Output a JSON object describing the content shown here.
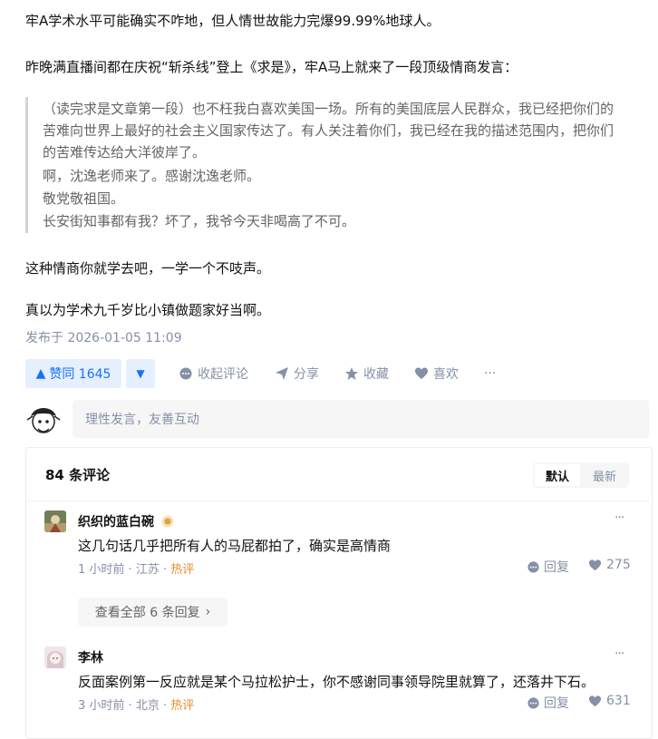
{
  "article": {
    "p1": "牢A学术水平可能确实不咋地，但人情世故能力完爆99.99%地球人。",
    "p2": "昨晚满直播间都在庆祝“斩杀线”登上《求是》，牢A马上就来了一段顶级情商发言：",
    "quote": [
      "（读完求是文章第一段）也不枉我白喜欢美国一场。所有的美国底层人民群众，我已经把你们的",
      "苦难向世界上最好的社会主义国家传达了。有人关注着你们，我已经在我的描述范围内，把你们",
      "的苦难传达给大洋彼岸了。",
      "啊，沈逸老师来了。感谢沈逸老师。",
      "敬党敬祖国。",
      "长安街知事都有我？坏了，我爷今天非喝高了不可。"
    ],
    "p3": "这种情商你就学去吧，一学一个不吱声。",
    "p4": "真以为学术九千岁比小镇做题家好当啊。",
    "published": "发布于 2026-01-05 11:09"
  },
  "actions": {
    "upvote": "赞同 1645",
    "collapse_comments": "收起评论",
    "share": "分享",
    "favorite": "收藏",
    "like": "喜欢",
    "more": "···"
  },
  "composer": {
    "placeholder": "理性发言，友善互动"
  },
  "comments": {
    "count": "84 条评论",
    "sort_default": "默认",
    "sort_latest": "最新",
    "items": [
      {
        "author": "织织的蓝白碗",
        "text": "这几句话几乎把所有人的马屁都拍了，确实是高情商",
        "time": "1 小时前",
        "location": "江苏",
        "tag": "热评",
        "reply": "回复",
        "likes": "275"
      },
      {
        "author": "李林",
        "text": "反面案例第一反应就是某个马拉松护士，你不感谢同事领导院里就算了，还落井下石。",
        "time": "3 小时前",
        "location": "北京",
        "tag": "热评",
        "reply": "回复",
        "likes": "631"
      }
    ],
    "view_all_replies": "查看全部 6 条回复",
    "menu": "···"
  },
  "colors": {
    "accent": "#1772f6",
    "accent_bg": "#e5effe",
    "muted": "#8590a6",
    "hot": "#ea8a2a"
  }
}
